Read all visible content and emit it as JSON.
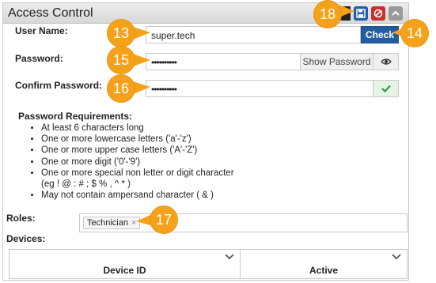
{
  "panel": {
    "title": "Access Control",
    "icons": [
      "save-icon",
      "cancel-icon",
      "collapse-icon"
    ]
  },
  "form": {
    "username_label": "User Name:",
    "username_value": "super.tech",
    "check_button": "Check",
    "password_label": "Password:",
    "password_value": "••••••••••",
    "show_password": "Show Password",
    "confirm_label": "Confirm Password:",
    "confirm_value": "••••••••••"
  },
  "requirements": {
    "title": "Password Requirements:",
    "items": [
      "At least 6 characters long",
      "One or more lowercase letters ('a'-'z')",
      "One or more upper case letters ('A'-'Z')",
      "One or more digit ('0'-'9')",
      "One or more special non letter or digit character (eg ! @ : # ; $ % , ^ * )",
      "May not contain ampersand character ( & )"
    ]
  },
  "roles": {
    "label": "Roles:",
    "tags": [
      "Technician"
    ],
    "remove_glyph": "×"
  },
  "devices": {
    "label": "Devices:",
    "columns": [
      "Device ID",
      "Active"
    ]
  },
  "callouts": [
    "13",
    "14",
    "15",
    "16",
    "17",
    "18"
  ],
  "colors": {
    "callout": "#f5a21a",
    "primary": "#245d9f",
    "danger": "#c9302c",
    "success_check": "#2e9e3f"
  }
}
